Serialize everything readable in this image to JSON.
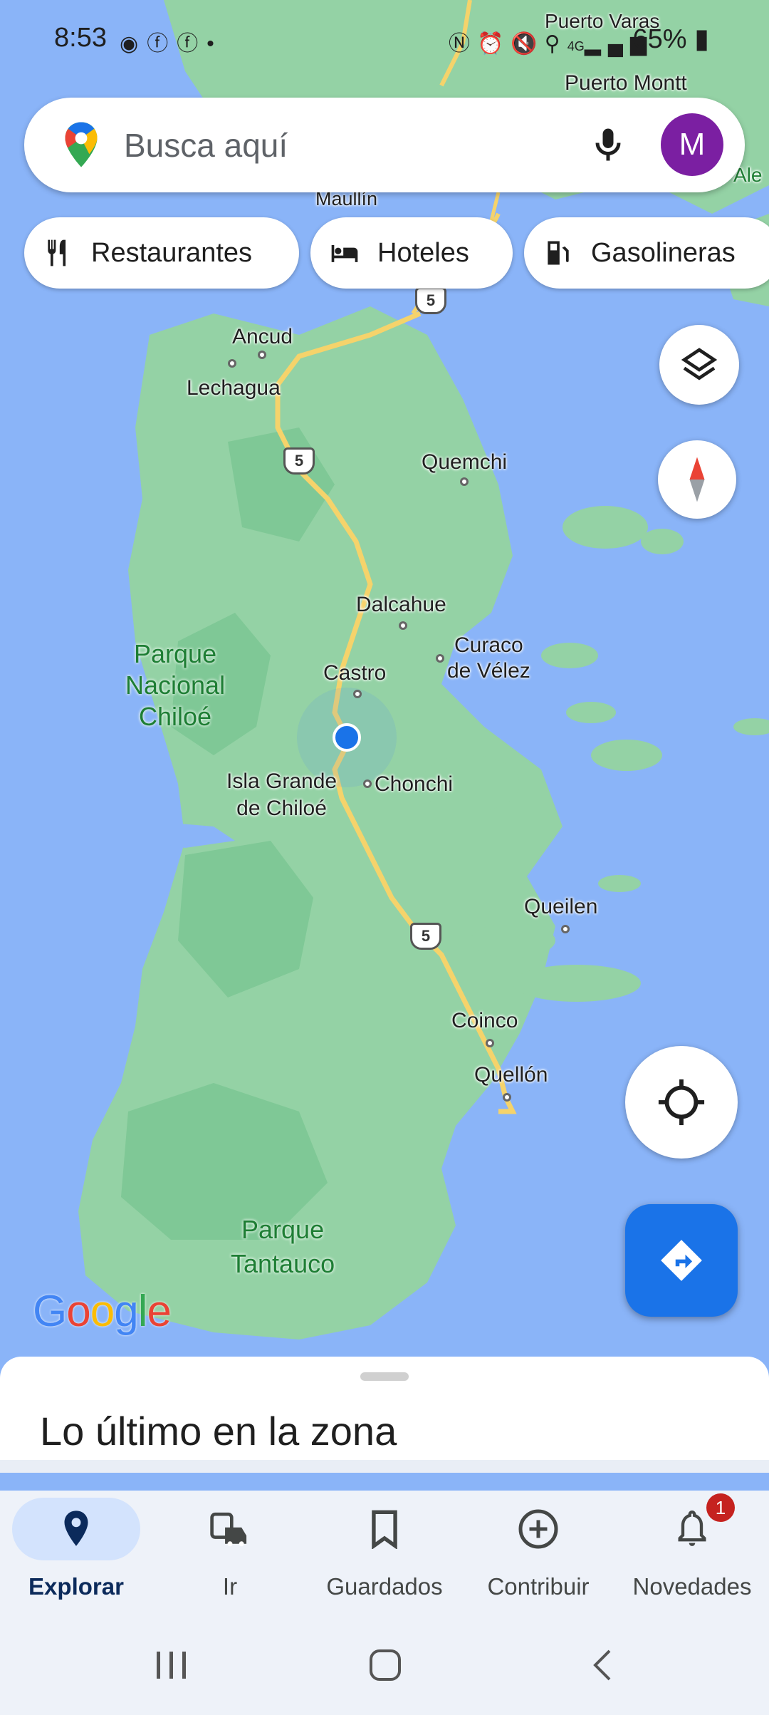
{
  "status_bar": {
    "time": "8:53",
    "left_icons": [
      "messenger-icon",
      "facebook-icon",
      "facebook-icon",
      "dot-icon"
    ],
    "right_icons": [
      "nfc-icon",
      "alarm-icon",
      "mute-icon",
      "location-icon",
      "signal-icon"
    ],
    "network": "4G",
    "battery": "65%"
  },
  "search": {
    "placeholder": "Busca aquí",
    "avatar_letter": "M"
  },
  "chips": [
    {
      "label": "Restaurantes",
      "icon": "restaurant-icon"
    },
    {
      "label": "Hoteles",
      "icon": "hotel-icon"
    },
    {
      "label": "Gasolineras",
      "icon": "gas-station-icon"
    }
  ],
  "map": {
    "places": {
      "puerto_varas": "Puerto Varas",
      "puerto_montt": "Puerto Montt",
      "maullin": "Maullín",
      "ale": "Ale",
      "ancud": "Ancud",
      "lechagua": "Lechagua",
      "quemchi": "Quemchi",
      "dalcahue": "Dalcahue",
      "castro": "Castro",
      "curaco": "Curaco\nde Vélez",
      "isla_grande": "Isla Grande\nde Chiloé",
      "chonchi": "Chonchi",
      "queilen": "Queilen",
      "coinco": "Coinco",
      "quellon": "Quellón"
    },
    "parks": {
      "chiloe": "Parque\nNacional\nChiloé",
      "tantauco": "Parque\nTantauco"
    },
    "route_number": "5",
    "logo": "Google",
    "colors": {
      "water": "#8ab4f8",
      "land": "#94d2a5",
      "land_dark": "#7fc896",
      "road": "#f5d36b"
    }
  },
  "sheet": {
    "title": "Lo último en la zona"
  },
  "nav": {
    "items": [
      {
        "label": "Explorar",
        "icon": "location-pin-icon",
        "active": true
      },
      {
        "label": "Ir",
        "icon": "commute-icon"
      },
      {
        "label": "Guardados",
        "icon": "bookmark-icon"
      },
      {
        "label": "Contribuir",
        "icon": "add-circle-icon"
      },
      {
        "label": "Novedades",
        "icon": "bell-icon",
        "badge": "1"
      }
    ]
  },
  "system_nav": [
    "recents-icon",
    "home-icon",
    "back-icon"
  ]
}
